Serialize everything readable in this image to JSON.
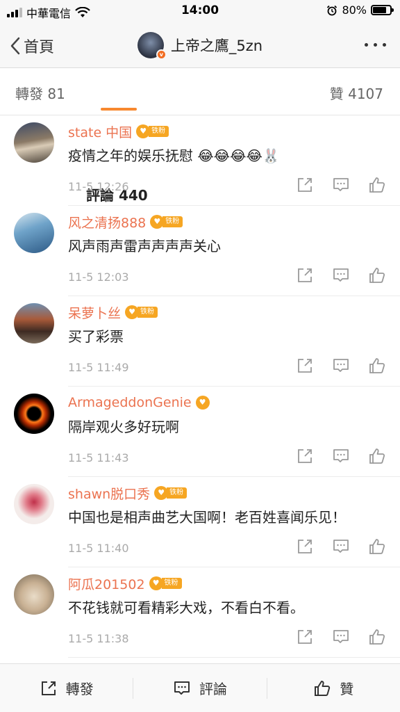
{
  "status_bar": {
    "carrier": "中華電信",
    "time": "14:00",
    "battery": "80%",
    "battery_level": 0.8
  },
  "nav": {
    "back_label": "首頁",
    "title": "上帝之鷹_5zn"
  },
  "tabs": {
    "forward": "轉發 81",
    "comments": "評論 440",
    "likes": "贊 4107"
  },
  "fan_badge_label": "铁粉",
  "comments": [
    {
      "user": "state 中国",
      "text": "疫情之年的娱乐抚慰 😂😂😂😂🐰",
      "time": "11-5 12:26",
      "fan": true
    },
    {
      "user": "风之清扬888",
      "text": "风声雨声雷声声声声关心",
      "time": "11-5 12:03",
      "fan": true
    },
    {
      "user": "呆萝卜丝",
      "text": "买了彩票",
      "time": "11-5 11:49",
      "fan": true
    },
    {
      "user": "ArmageddonGenie",
      "text": "隔岸观火多好玩啊",
      "time": "11-5 11:43",
      "fan": false
    },
    {
      "user": "shawn脱口秀",
      "text": "中国也是相声曲艺大国啊！老百姓喜闻乐见！",
      "time": "11-5 11:40",
      "fan": true
    },
    {
      "user": "阿瓜201502",
      "text": "不花钱就可看精彩大戏，不看白不看。",
      "time": "11-5 11:38",
      "fan": true
    }
  ],
  "bottom_bar": {
    "forward": "轉發",
    "comment": "評論",
    "like": "贊"
  },
  "colors": {
    "username": "#eb7350",
    "accent": "#f7882f",
    "badge": "#f6a623"
  }
}
